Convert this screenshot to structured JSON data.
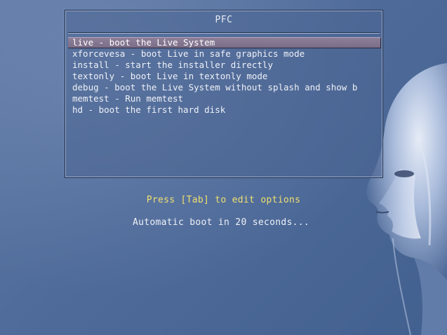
{
  "menu": {
    "title": "PFC",
    "items": [
      {
        "label": "live - boot the Live System",
        "selected": true
      },
      {
        "label": "xforcevesa - boot Live in safe graphics mode",
        "selected": false
      },
      {
        "label": "install - start the installer directly",
        "selected": false
      },
      {
        "label": "textonly - boot Live in textonly mode",
        "selected": false
      },
      {
        "label": "debug - boot the Live System without splash and show b",
        "selected": false
      },
      {
        "label": "memtest - Run memtest",
        "selected": false
      },
      {
        "label": "hd - boot the first hard disk",
        "selected": false
      }
    ]
  },
  "hints": {
    "tab_hint": "Press [Tab] to edit options",
    "countdown": "Automatic boot in 20 seconds..."
  },
  "colors": {
    "background": "#4f6b99",
    "selected_item": "#857892",
    "hint_yellow": "#f0e070",
    "text": "#eef1f7"
  },
  "icons": {
    "background_art": "robot-head-illustration"
  }
}
